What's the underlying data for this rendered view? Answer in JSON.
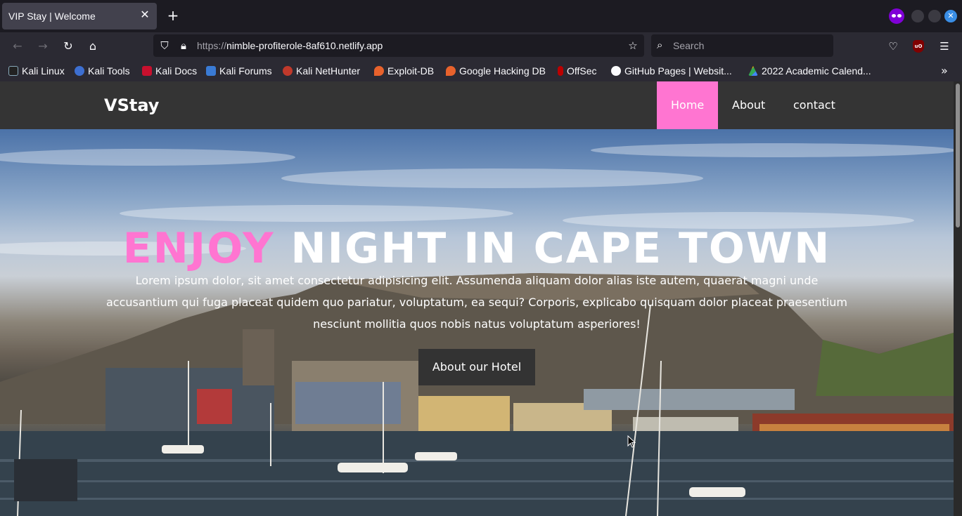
{
  "browser": {
    "tab_title": "VIP Stay | Welcome",
    "url_protocol": "https://",
    "url_host": "nimble-profiterole-8af610.netlify.app",
    "search_placeholder": "Search",
    "bookmarks": [
      "Kali Linux",
      "Kali Tools",
      "Kali Docs",
      "Kali Forums",
      "Kali NetHunter",
      "Exploit-DB",
      "Google Hacking DB",
      "OffSec",
      "GitHub Pages | Websit...",
      "2022 Academic Calend..."
    ]
  },
  "site": {
    "logo": "VStay",
    "nav": [
      "Home",
      "About",
      "contact"
    ],
    "active_nav": "Home",
    "hero": {
      "title_accent": "ENJOY",
      "title_rest": "NIGHT IN CAPE TOWN",
      "paragraph": "Lorem ipsum dolor, sit amet consectetur adipisicing elit. Assumenda aliquam dolor alias iste autem, quaerat magni unde accusantium qui fuga placeat quidem quo pariatur, voluptatum, ea sequi? Corporis, explicabo quisquam dolor placeat praesentium nesciunt mollitia quos nobis natus voluptatum asperiores!",
      "button": "About our Hotel"
    },
    "colors": {
      "accent": "#ff75d1",
      "nav_bg": "#343434",
      "button_bg": "#333333"
    }
  }
}
